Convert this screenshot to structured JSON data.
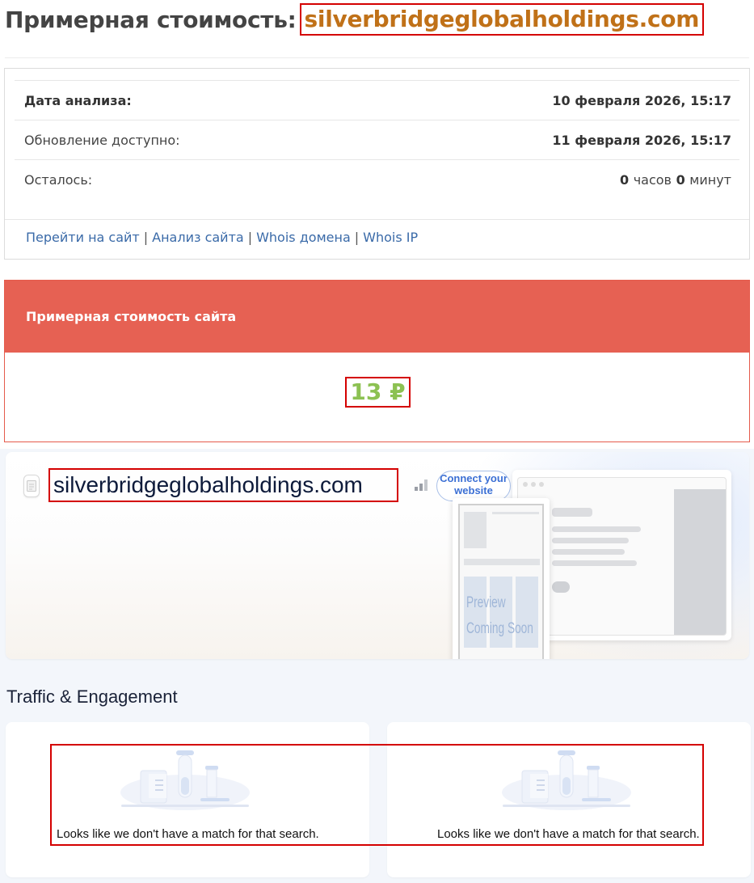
{
  "header": {
    "title_prefix": "Примерная стоимость:",
    "domain": "silverbridgeglobalholdings.com"
  },
  "info": {
    "rows": [
      {
        "label": "Дата анализа:",
        "value": "10 февраля 2026, 15:17"
      },
      {
        "label": "Обновление доступно:",
        "value": "11 февраля 2026, 15:17"
      },
      {
        "label": "Осталось:",
        "hours": "0",
        "hours_unit": "часов",
        "minutes": "0",
        "minutes_unit": "минут"
      }
    ],
    "links": [
      "Перейти на сайт",
      "Анализ сайта",
      "Whois домена",
      "Whois IP"
    ],
    "separator": "|"
  },
  "cost": {
    "heading": "Примерная стоимость сайта",
    "value": "13 ₽"
  },
  "preview": {
    "domain": "silverbridgeglobalholdings.com",
    "connect_label": "Connect your website",
    "preview_line1": "Preview",
    "preview_line2": "Coming Soon",
    "icons": [
      "file-icon",
      "signal-bars-icon"
    ]
  },
  "traffic": {
    "title": "Traffic & Engagement",
    "cards": [
      {
        "empty_text": "Looks like we don't have a match for that search."
      },
      {
        "empty_text": "Looks like we don't have a match for that search."
      }
    ]
  },
  "colors": {
    "domain_title": "#c07118",
    "cost_header": "#e66153",
    "cost_value": "#8cc152",
    "link": "#3a6aa8",
    "highlight_box": "#d40000"
  }
}
